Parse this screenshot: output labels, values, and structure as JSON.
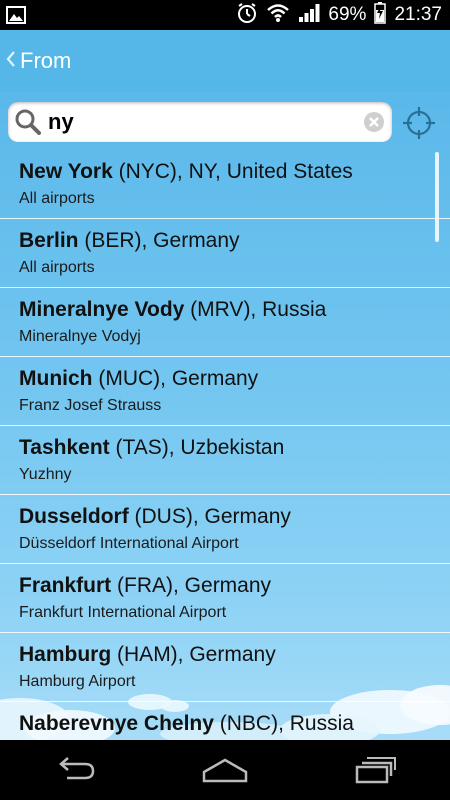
{
  "status_bar": {
    "battery": "69%",
    "time": "21:37"
  },
  "action_bar": {
    "title": "From"
  },
  "search": {
    "value": "ny",
    "placeholder": ""
  },
  "results": [
    {
      "city": "New York",
      "code_rest": " (NYC), NY, United States",
      "sub": "All airports"
    },
    {
      "city": "Berlin",
      "code_rest": " (BER), Germany",
      "sub": "All airports"
    },
    {
      "city": "Mineralnye Vody",
      "code_rest": " (MRV), Russia",
      "sub": "Mineralnye Vodyj"
    },
    {
      "city": "Munich",
      "code_rest": " (MUC), Germany",
      "sub": "Franz Josef Strauss"
    },
    {
      "city": "Tashkent",
      "code_rest": " (TAS), Uzbekistan",
      "sub": "Yuzhny"
    },
    {
      "city": "Dusseldorf",
      "code_rest": " (DUS), Germany",
      "sub": "Düsseldorf International Airport"
    },
    {
      "city": "Frankfurt",
      "code_rest": " (FRA), Germany",
      "sub": "Frankfurt International Airport"
    },
    {
      "city": "Hamburg",
      "code_rest": " (HAM), Germany",
      "sub": "Hamburg Airport"
    },
    {
      "city": "Naberevnye Chelny",
      "code_rest": " (NBC), Russia",
      "sub": ""
    }
  ],
  "icons": {
    "status_left": "image-notification-icon",
    "alarm": "alarm-icon",
    "wifi": "wifi-icon",
    "signal": "signal-icon",
    "battery": "battery-charging-icon",
    "back": "chevron-left-icon",
    "search": "search-icon",
    "clear": "clear-icon",
    "locate": "crosshair-locate-icon",
    "nav_back": "back-icon",
    "nav_home": "home-icon",
    "nav_recents": "recents-icon"
  }
}
